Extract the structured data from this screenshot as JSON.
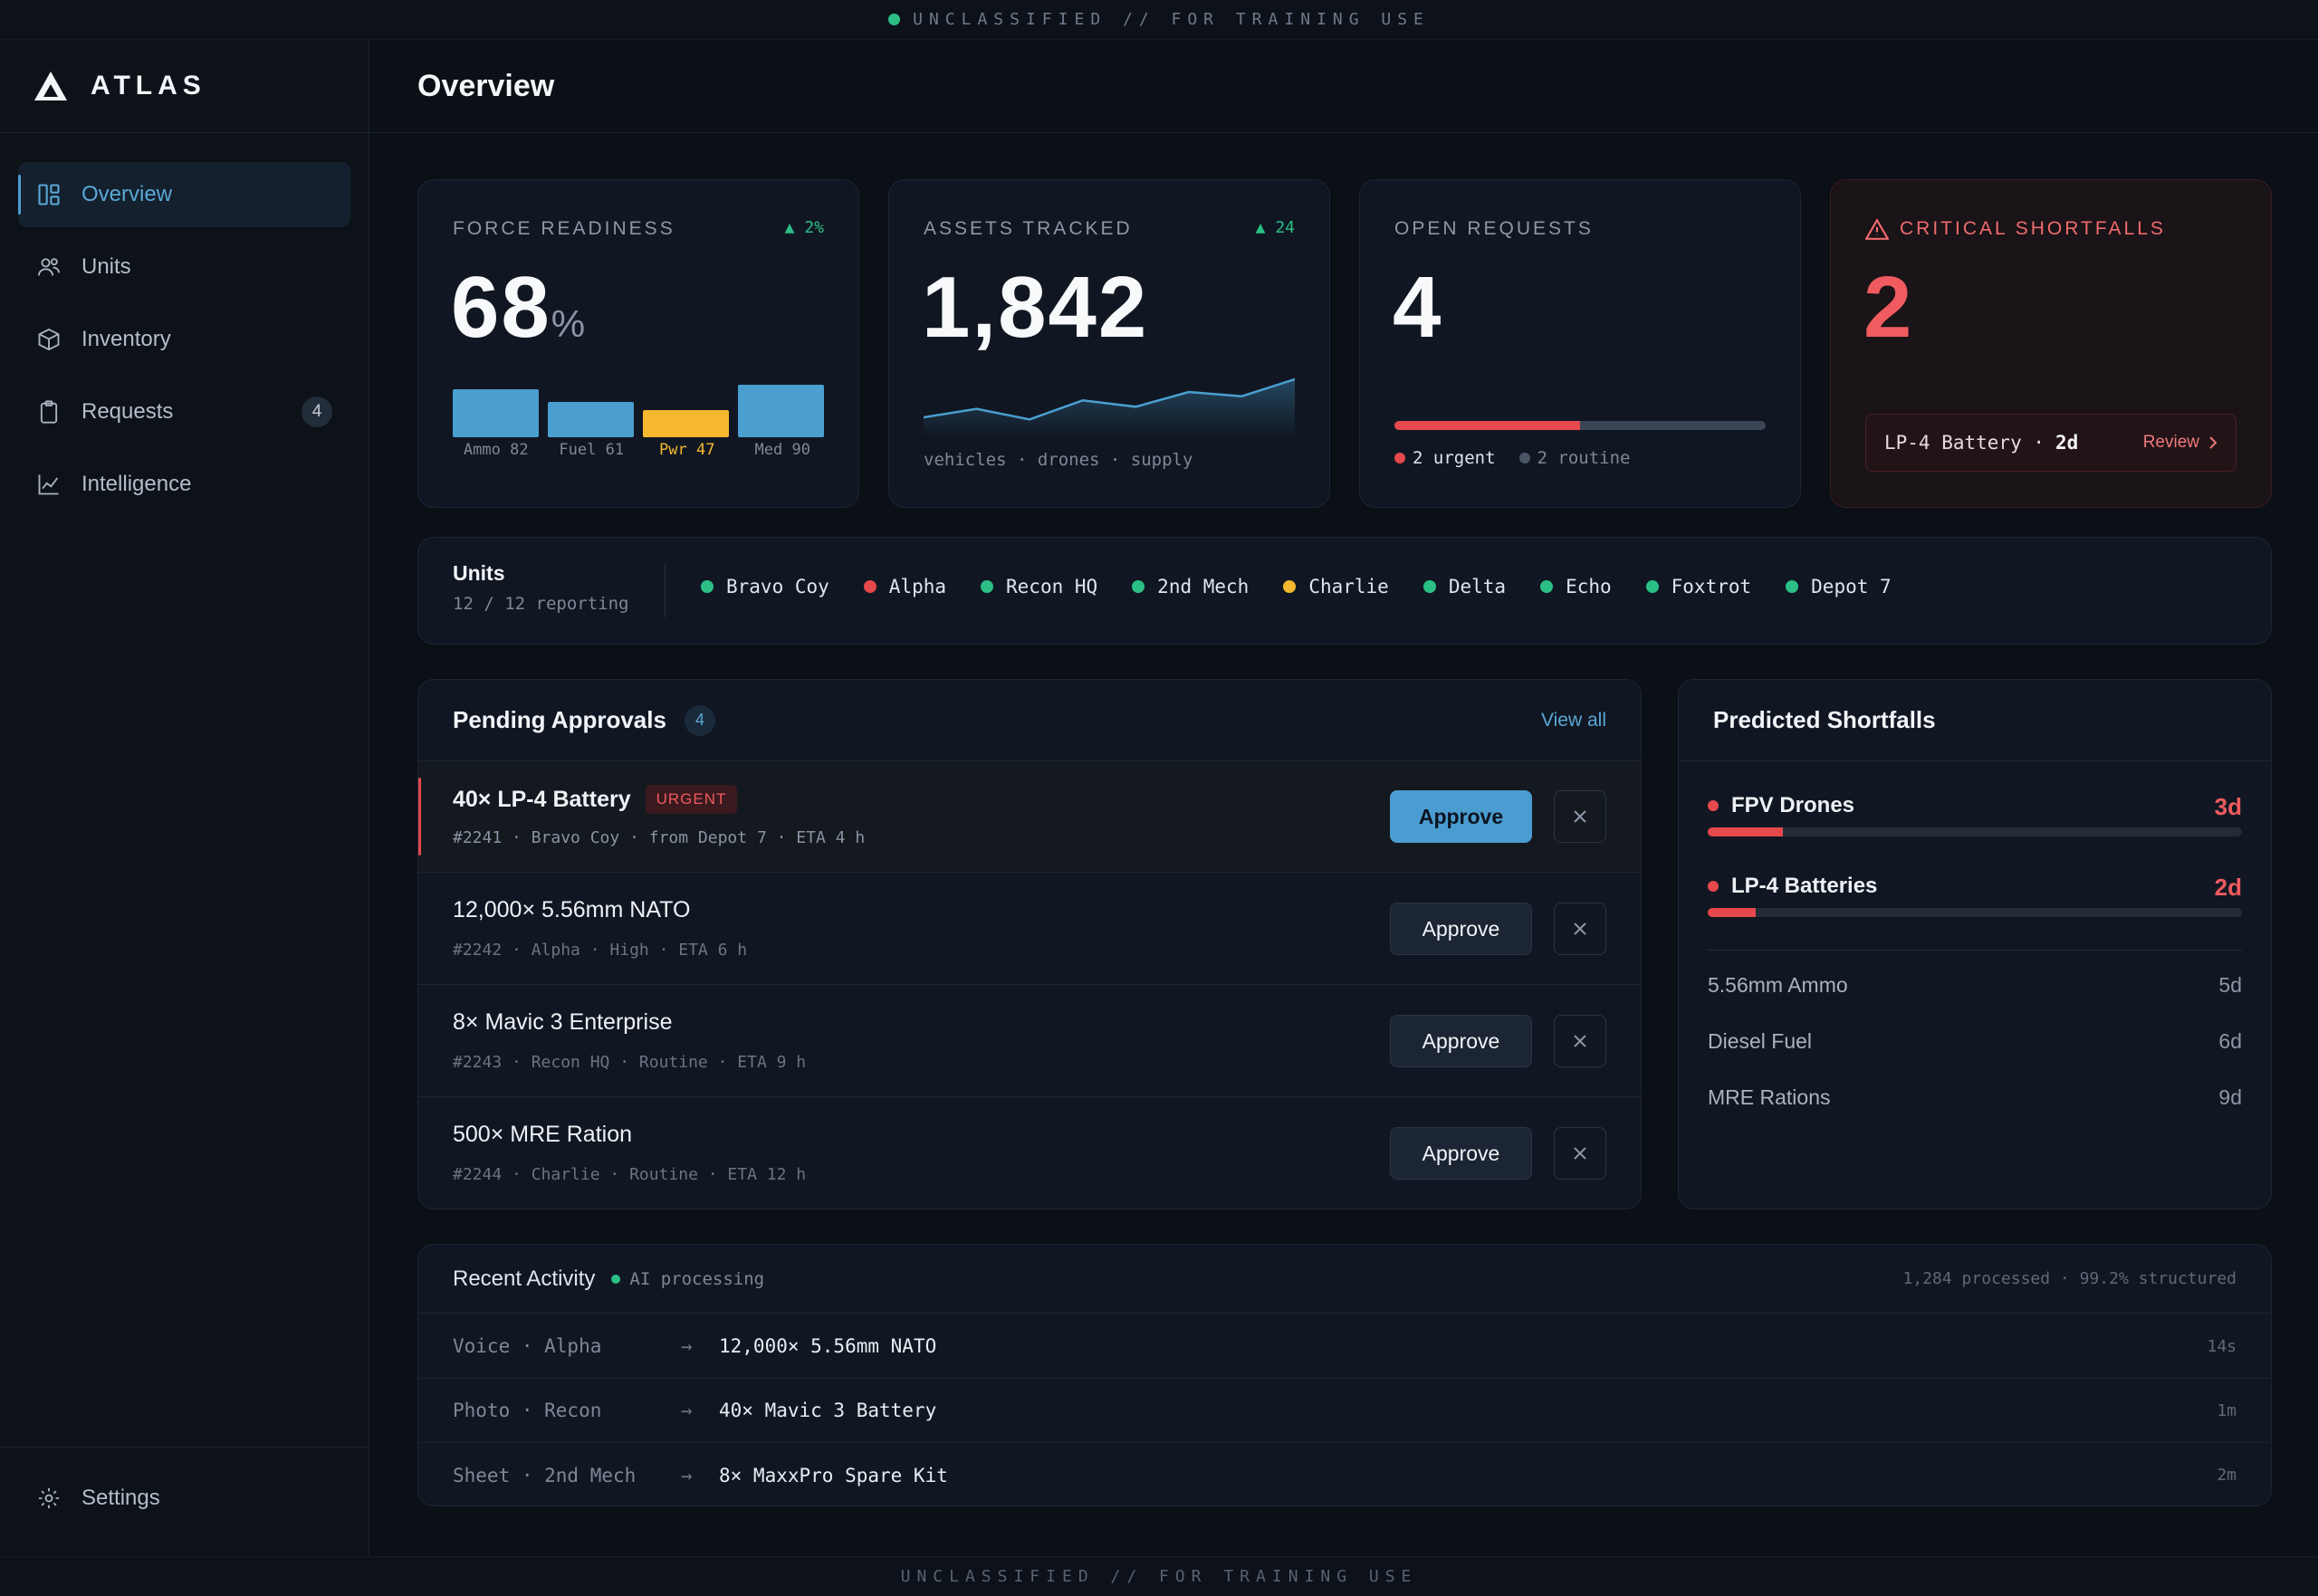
{
  "banner": {
    "top": "UNCLASSIFIED // FOR TRAINING USE",
    "bottom": "UNCLASSIFIED // FOR TRAINING USE"
  },
  "brand": "ATLAS",
  "nav": [
    {
      "label": "Overview",
      "icon": "layout-icon"
    },
    {
      "label": "Units",
      "icon": "users-icon"
    },
    {
      "label": "Inventory",
      "icon": "box-icon"
    },
    {
      "label": "Requests",
      "icon": "clipboard-icon",
      "badge": "4"
    },
    {
      "label": "Intelligence",
      "icon": "chart-line-icon"
    }
  ],
  "settings_label": "Settings",
  "page_title": "Overview",
  "kpis": {
    "readiness": {
      "label": "FORCE READINESS",
      "delta": "▲ 2%",
      "value": "68",
      "unit": "%",
      "bars": [
        {
          "label": "Ammo 82",
          "value": 82,
          "color": "#4a9fd0"
        },
        {
          "label": "Fuel 61",
          "value": 61,
          "color": "#4a9fd0"
        },
        {
          "label": "Pwr 47",
          "value": 47,
          "color": "#f5b82e"
        },
        {
          "label": "Med 90",
          "value": 90,
          "color": "#4a9fd0"
        }
      ]
    },
    "assets": {
      "label": "ASSETS TRACKED",
      "delta": "▲ 24",
      "value": "1,842",
      "trend": [
        20,
        28,
        18,
        36,
        30,
        44,
        40,
        56
      ],
      "footer": "vehicles · drones · supply"
    },
    "requests": {
      "label": "OPEN REQUESTS",
      "value": "4",
      "urgent_fraction": 0.5,
      "urgent_label": "2 urgent",
      "routine_label": "2 routine"
    },
    "critical": {
      "label": "CRITICAL SHORTFALLS",
      "value": "2",
      "item": "LP-4 Battery ·",
      "item_days": "2d",
      "review": "Review"
    }
  },
  "units": {
    "title": "Units",
    "reporting": "12 / 12 reporting",
    "list": [
      {
        "name": "Bravo Coy",
        "status": "#2bbf86"
      },
      {
        "name": "Alpha",
        "status": "#e5484d"
      },
      {
        "name": "Recon HQ",
        "status": "#2bbf86"
      },
      {
        "name": "2nd Mech",
        "status": "#2bbf86"
      },
      {
        "name": "Charlie",
        "status": "#f5b82e"
      },
      {
        "name": "Delta",
        "status": "#2bbf86"
      },
      {
        "name": "Echo",
        "status": "#2bbf86"
      },
      {
        "name": "Foxtrot",
        "status": "#2bbf86"
      },
      {
        "name": "Depot 7",
        "status": "#2bbf86"
      }
    ]
  },
  "approvals": {
    "title": "Pending Approvals",
    "count": "4",
    "view_all": "View all",
    "approve_label": "Approve",
    "items": [
      {
        "title": "40× LP-4 Battery",
        "tag": "URGENT",
        "meta": "#2241 · Bravo Coy · from Depot 7 · ETA 4 h"
      },
      {
        "title": "12,000× 5.56mm NATO",
        "meta": "#2242 · Alpha · High · ETA 6 h"
      },
      {
        "title": "8× Mavic 3 Enterprise",
        "meta": "#2243 · Recon HQ · Routine · ETA 9 h"
      },
      {
        "title": "500× MRE Ration",
        "meta": "#2244 · Charlie · Routine · ETA 12 h"
      }
    ]
  },
  "shortfalls": {
    "title": "Predicted Shortfalls",
    "critical": [
      {
        "name": "FPV Drones",
        "days": "3d",
        "level": 0.14
      },
      {
        "name": "LP-4 Batteries",
        "days": "2d",
        "level": 0.09
      }
    ],
    "other": [
      {
        "name": "5.56mm Ammo",
        "days": "5d"
      },
      {
        "name": "Diesel Fuel",
        "days": "6d"
      },
      {
        "name": "MRE Rations",
        "days": "9d"
      }
    ]
  },
  "activity": {
    "title": "Recent Activity",
    "ai_label": "AI processing",
    "stats": "1,284 processed · 99.2% structured",
    "rows": [
      {
        "source": "Voice · Alpha",
        "item": "12,000× 5.56mm NATO",
        "time": "14s"
      },
      {
        "source": "Photo · Recon",
        "item": "40× Mavic 3 Battery",
        "time": "1m"
      },
      {
        "source": "Sheet · 2nd Mech",
        "item": "8× MaxxPro Spare Kit",
        "time": "2m"
      }
    ]
  }
}
